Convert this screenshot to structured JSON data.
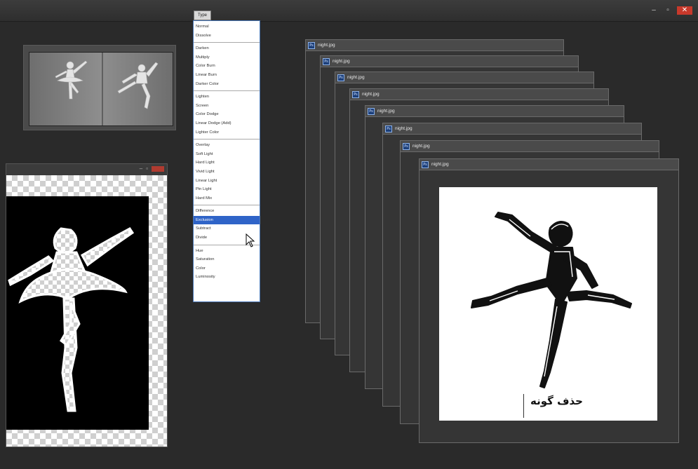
{
  "window": {
    "controls": {
      "minimize": "–",
      "restore": "▫",
      "close": "✕"
    }
  },
  "blend_mode": {
    "current_label": "Type",
    "groups": [
      [
        "Normal",
        "Dissolve"
      ],
      [
        "Darken",
        "Multiply",
        "Color Burn",
        "Linear Burn",
        "Darker Color"
      ],
      [
        "Lighten",
        "Screen",
        "Color Dodge",
        "Linear Dodge (Add)",
        "Lighter Color"
      ],
      [
        "Overlay",
        "Soft Light",
        "Hard Light",
        "Vivid Light",
        "Linear Light",
        "Pin Light",
        "Hard Mix"
      ],
      [
        "Difference",
        "Exclusion",
        "Subtract",
        "Divide"
      ],
      [
        "Hue",
        "Saturation",
        "Color",
        "Luminosity"
      ]
    ],
    "selected": "Exclusion"
  },
  "documents": {
    "stack_title": "night.jpg",
    "stack_icon": "Ps",
    "caption": "حذف گونه"
  },
  "colors": {
    "accent": "#2f64c8",
    "close": "#c8392b",
    "background": "#2a2a2a"
  },
  "icons": {
    "app": "photoshop-icon",
    "cursor": "arrow-cursor-icon"
  }
}
